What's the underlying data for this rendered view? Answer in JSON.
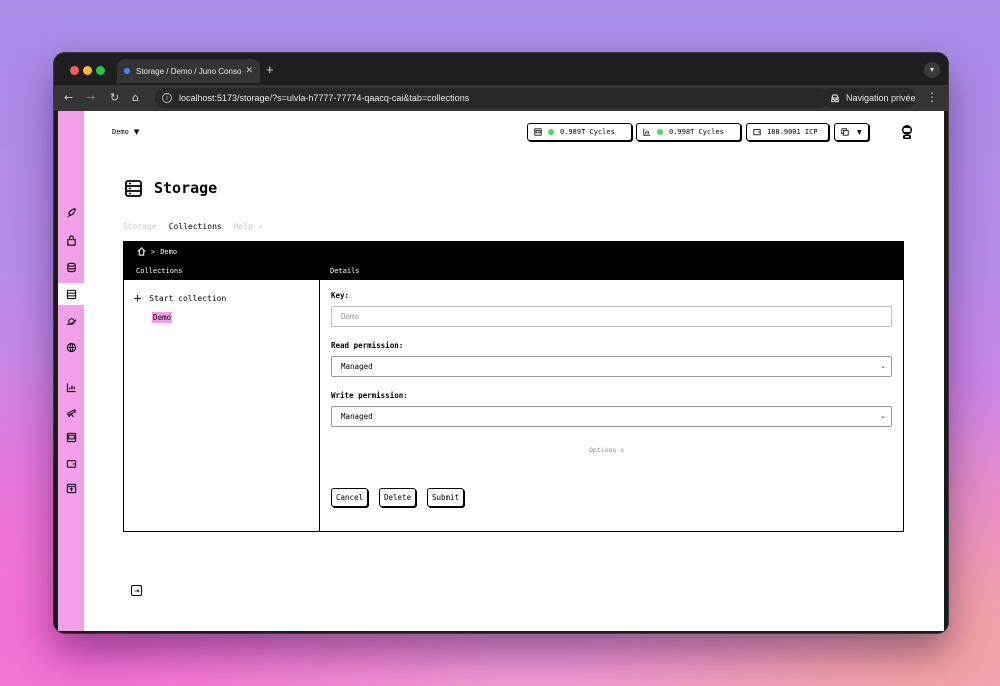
{
  "browser": {
    "tab_title": "Storage / Demo / Juno Conso",
    "url": "localhost:5173/storage/?s=ulvla-h7777-77774-qaacq-cai&tab=collections",
    "private_label": "Navigation privée",
    "tab_close": "✕",
    "new_tab": "+"
  },
  "header": {
    "satellite": "Demo",
    "satellite_cycles": "0.989T Cycles",
    "orbiter_cycles": "0.998T Cycles",
    "icp_balance": "188.9001 ICP",
    "status_color": "#4cd964"
  },
  "page": {
    "title": "Storage",
    "tabs": [
      {
        "label": "Storage",
        "active": false
      },
      {
        "label": "Collections",
        "active": true
      },
      {
        "label": "Help ↗",
        "active": false
      }
    ]
  },
  "panel": {
    "breadcrumb_home": "home-icon",
    "breadcrumb_sep": ">",
    "breadcrumb_current": "Demo",
    "col_collections": "Collections",
    "col_details": "Details",
    "start_collection": "Start collection",
    "start_icon": "+",
    "collections": [
      "Demo"
    ]
  },
  "form": {
    "key_label": "Key:",
    "key_placeholder": "Demo",
    "read_label": "Read permission:",
    "read_value": "Managed",
    "write_label": "Write permission:",
    "write_value": "Managed",
    "options_label": "Options ↕",
    "cancel": "Cancel",
    "delete": "Delete",
    "submit": "Submit"
  },
  "colors": {
    "accent": "#f29ee9",
    "ink": "#000000"
  }
}
